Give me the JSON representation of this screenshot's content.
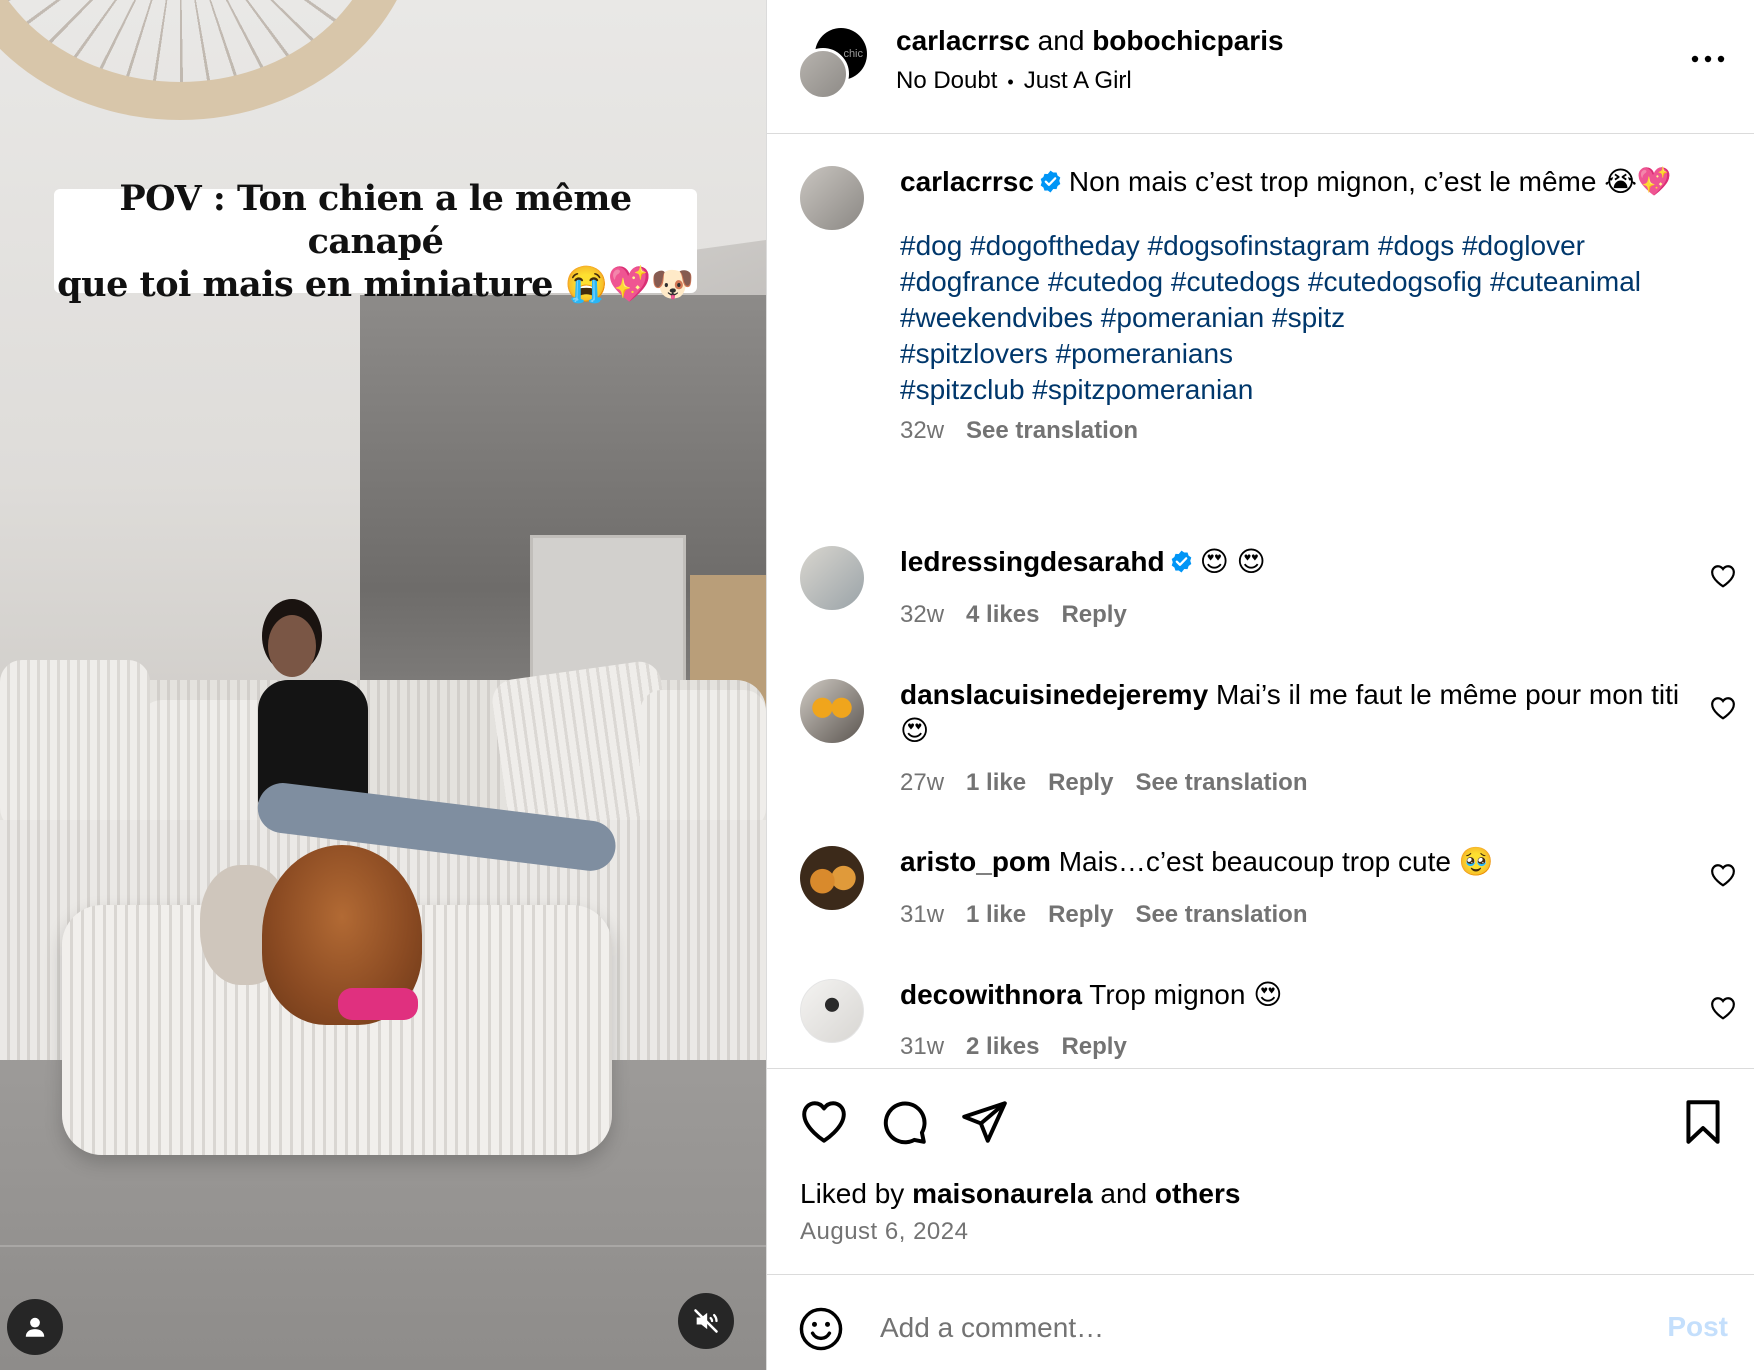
{
  "video": {
    "overlay_line1": "POV : Ton chien a le même canapé",
    "overlay_line2": "que toi mais en miniature 😭💖🐶"
  },
  "header": {
    "author1": "carlacrrsc",
    "joiner": " and ",
    "author2": "bobochicparis",
    "avatar_text": "chic",
    "audio_artist": "No Doubt",
    "audio_separator": "•",
    "audio_song": "Just A Girl",
    "more_icon": "more-horizontal-icon"
  },
  "caption": {
    "username": "carlacrrsc",
    "text": "Non mais c’est trop mignon, c’est le même 😭💖",
    "hashtag_lines": [
      "#dog #dogoftheday #dogsofinstagram #dogs #doglover",
      "#dogfrance #cutedog #cutedogs #cutedogsofig #cuteanimal",
      "#weekendvibes #pomeranian #spitz",
      "#spitzlovers #pomeranians",
      "#spitzclub #spitzpomeranian"
    ],
    "time": "32w",
    "see_translation": "See translation"
  },
  "comments": [
    {
      "username": "ledressingdesarahd",
      "verified": true,
      "text": "😍 😍",
      "time": "32w",
      "likes": "4 likes",
      "reply": "Reply",
      "see_translation": ""
    },
    {
      "username": "danslacuisinedejeremy",
      "verified": false,
      "text": "Mai’s il me faut le même pour mon titi😍",
      "time": "27w",
      "likes": "1 like",
      "reply": "Reply",
      "see_translation": "See translation"
    },
    {
      "username": "aristo_pom",
      "verified": false,
      "text": "Mais…c’est beaucoup trop cute 🥹",
      "time": "31w",
      "likes": "1 like",
      "reply": "Reply",
      "see_translation": "See translation"
    },
    {
      "username": "decowithnora",
      "verified": false,
      "text": "Trop mignon 😍",
      "time": "31w",
      "likes": "2 likes",
      "reply": "Reply",
      "see_translation": ""
    }
  ],
  "actions": {
    "liked_by_prefix": "Liked by ",
    "liked_by_user": "maisonaurela",
    "liked_by_joiner": " and ",
    "liked_by_others": "others",
    "date": "August 6, 2024"
  },
  "composer": {
    "placeholder": "Add a comment…",
    "post_label": "Post"
  },
  "colors": {
    "hashtag": "#00376b",
    "verified": "#0095f6",
    "post_disabled": "#c4dffc",
    "secondary_text": "#737373"
  }
}
